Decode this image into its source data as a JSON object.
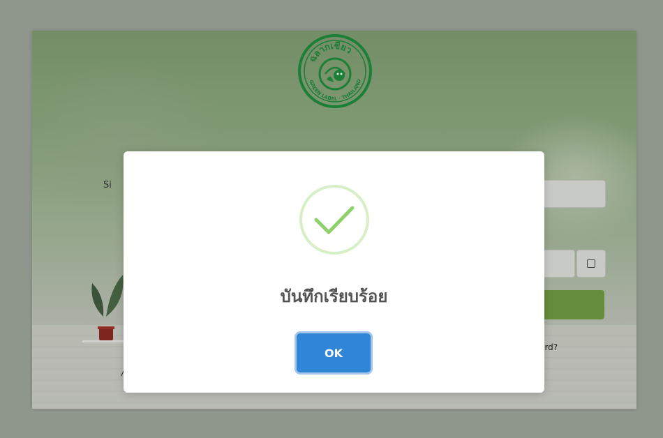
{
  "background": {
    "sign_in_text": "Si",
    "forgot_text": "vord?",
    "italic_fragment": "/",
    "logo": {
      "top_text": "ฉลากเขียว",
      "bottom_text": "GREEN LABEL · THAILAND",
      "icon": "green-label-logo"
    },
    "submit_color": "#6f9a43"
  },
  "modal": {
    "icon": "success-check-icon",
    "title": "บันทึกเรียบร้อย",
    "ok_label": "OK",
    "ok_color": "#3085d6"
  }
}
